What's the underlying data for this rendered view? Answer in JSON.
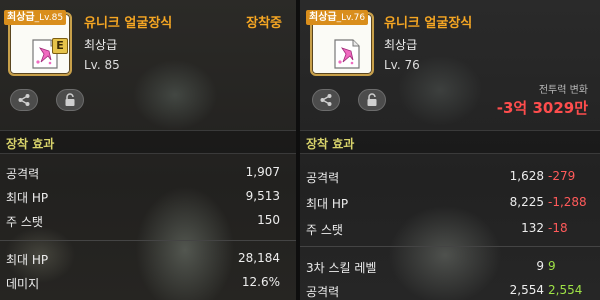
{
  "left": {
    "grade_tag": "최상급",
    "level_tag": "_Lv.85",
    "slot_badge": "E",
    "item_name": "유니크 얼굴장식",
    "equipped": "장착중",
    "grade": "최상급",
    "level": "Lv. 85",
    "section": "장착 효과",
    "stats": [
      {
        "label": "공격력",
        "value": "1,907"
      },
      {
        "label": "최대 HP",
        "value": "9,513"
      },
      {
        "label": "주 스탯",
        "value": "150"
      }
    ],
    "stats2": [
      {
        "label": "최대 HP",
        "value": "28,184"
      },
      {
        "label": "데미지",
        "value": "12.6%"
      }
    ]
  },
  "right": {
    "grade_tag": "최상급",
    "level_tag": "_Lv.76",
    "item_name": "유니크 얼굴장식",
    "grade": "최상급",
    "level": "Lv. 76",
    "cp_label": "전투력 변화",
    "cp_value": "-3억 3029만",
    "section": "장착 효과",
    "stats": [
      {
        "label": "공격력",
        "value": "1,628",
        "diff": "-279"
      },
      {
        "label": "최대 HP",
        "value": "8,225",
        "diff": "-1,288"
      },
      {
        "label": "주 스탯",
        "value": "132",
        "diff": "-18"
      }
    ],
    "stats2": [
      {
        "label": "3차 스킬 레벨",
        "value": "9",
        "diff": "9"
      },
      {
        "label": "공격력",
        "value": "2,554",
        "diff": "2,554"
      }
    ]
  },
  "icons": {
    "share": "share-icon",
    "lock": "lock-icon"
  },
  "colors": {
    "accent": "#f5a623",
    "section": "#d8d36b",
    "negative": "#ff5a5a",
    "positive": "#9ee246"
  }
}
